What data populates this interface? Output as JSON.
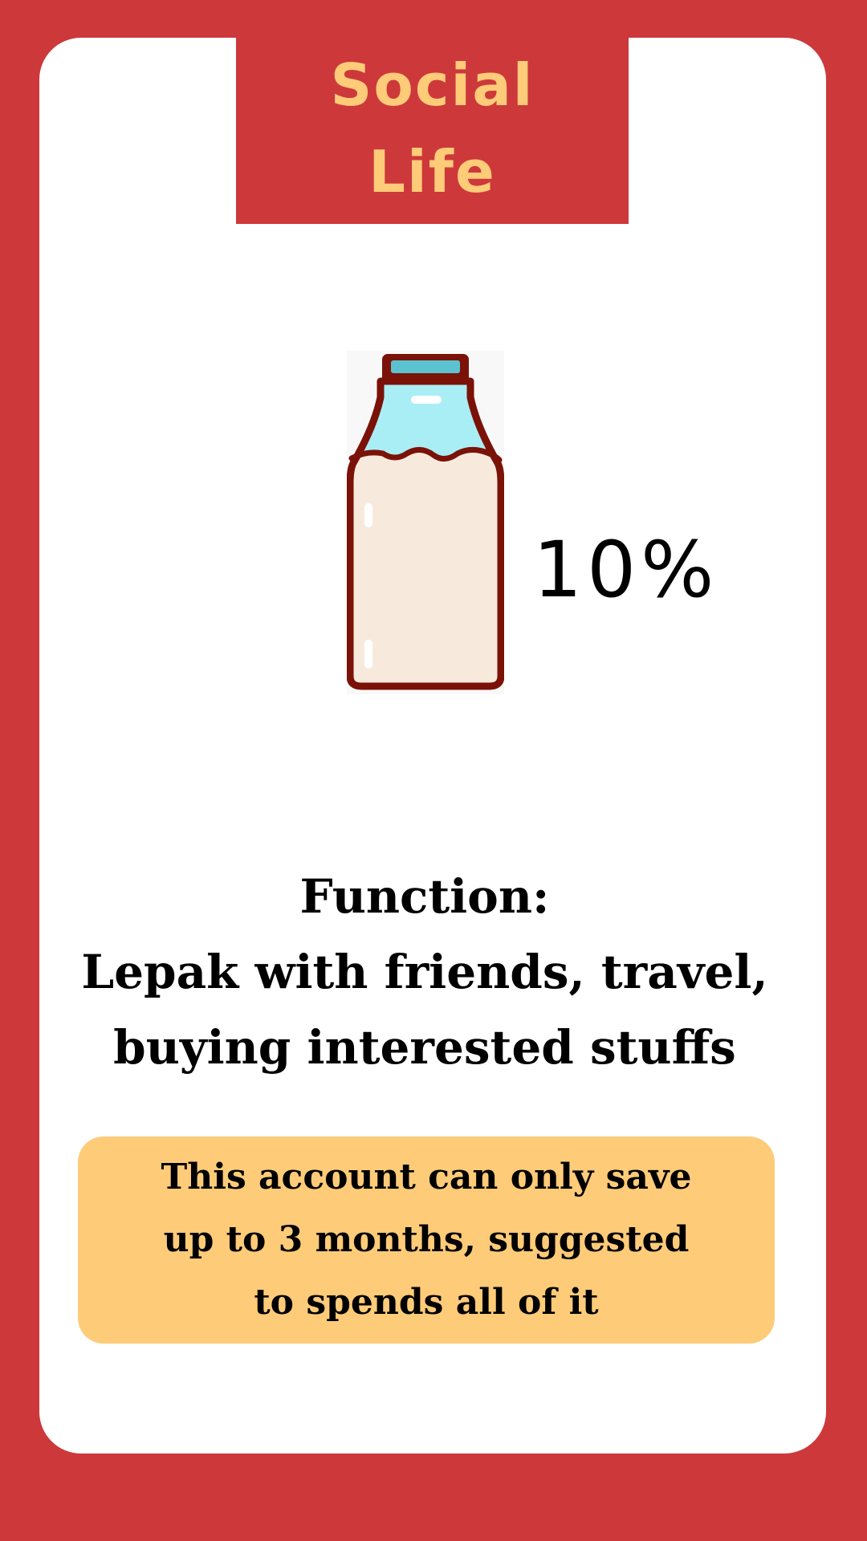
{
  "header": {
    "title": "Social\nLife"
  },
  "allocation": {
    "percent_label": "10%",
    "icon": "milk-bottle-icon"
  },
  "function": {
    "heading": "Function:",
    "line1": "Lepak with friends, travel,",
    "line2": "buying interested stuffs"
  },
  "note": {
    "text": "This account can only save\nup to 3 months, suggested\nto spends all of it"
  },
  "colors": {
    "background": "#cd383b",
    "card": "#ffffff",
    "title_text": "#fecb78",
    "note_background": "#fecb78",
    "bottle_outline": "#7a1208",
    "bottle_milk": "#f7eadd",
    "bottle_glass": "#aaeef5",
    "bottle_cap": "#5bc3cf"
  }
}
